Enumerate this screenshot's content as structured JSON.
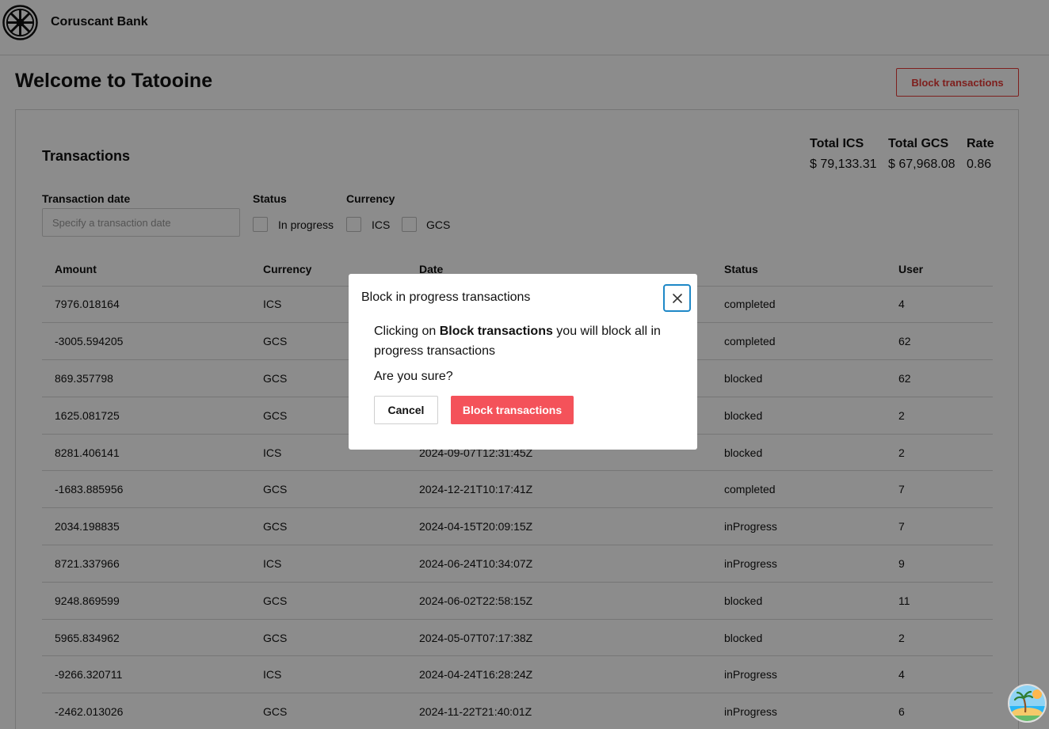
{
  "app": {
    "brand": "Coruscant Bank"
  },
  "page": {
    "title": "Welcome to Tatooine",
    "block_button_label": "Block transactions"
  },
  "card": {
    "title": "Transactions"
  },
  "totals": [
    {
      "label": "Total ICS",
      "value": "$ 79,133.31"
    },
    {
      "label": "Total GCS",
      "value": "$ 67,968.08"
    },
    {
      "label": "Rate",
      "value": "0.86"
    }
  ],
  "filters": {
    "date_label": "Transaction date",
    "date_placeholder": "Specify a transaction date",
    "status_label": "Status",
    "status_option": "In progress",
    "currency_label": "Currency",
    "currency_options": [
      "ICS",
      "GCS"
    ]
  },
  "table": {
    "headers": [
      "Amount",
      "Currency",
      "Date",
      "Status",
      "User"
    ],
    "rows": [
      [
        "7976.018164",
        "ICS",
        "",
        "completed",
        "4"
      ],
      [
        "-3005.594205",
        "GCS",
        "",
        "completed",
        "62"
      ],
      [
        "869.357798",
        "GCS",
        "",
        "blocked",
        "62"
      ],
      [
        "1625.081725",
        "GCS",
        "",
        "blocked",
        "2"
      ],
      [
        "8281.406141",
        "ICS",
        "2024-09-07T12:31:45Z",
        "blocked",
        "2"
      ],
      [
        "-1683.885956",
        "GCS",
        "2024-12-21T10:17:41Z",
        "completed",
        "7"
      ],
      [
        "2034.198835",
        "GCS",
        "2024-04-15T20:09:15Z",
        "inProgress",
        "7"
      ],
      [
        "8721.337966",
        "ICS",
        "2024-06-24T10:34:07Z",
        "inProgress",
        "9"
      ],
      [
        "9248.869599",
        "GCS",
        "2024-06-02T22:58:15Z",
        "blocked",
        "11"
      ],
      [
        "5965.834962",
        "GCS",
        "2024-05-07T07:17:38Z",
        "blocked",
        "2"
      ],
      [
        "-9266.320711",
        "ICS",
        "2024-04-24T16:28:24Z",
        "inProgress",
        "4"
      ],
      [
        "-2462.013026",
        "GCS",
        "2024-11-22T21:40:01Z",
        "inProgress",
        "6"
      ]
    ]
  },
  "modal": {
    "title": "Block in progress transactions",
    "body_prefix": "Clicking on ",
    "body_bold": "Block transactions",
    "body_suffix": " you will block all in progress transactions",
    "question": "Are you sure?",
    "cancel_label": "Cancel",
    "confirm_label": "Block transactions"
  },
  "icons": {
    "logo": "galactic-republic-logo-icon",
    "close": "close-icon",
    "badge": "beach-island-icon"
  },
  "colors": {
    "danger": "#e53935",
    "confirm": "#f4525a",
    "focus": "#1e88c7"
  }
}
